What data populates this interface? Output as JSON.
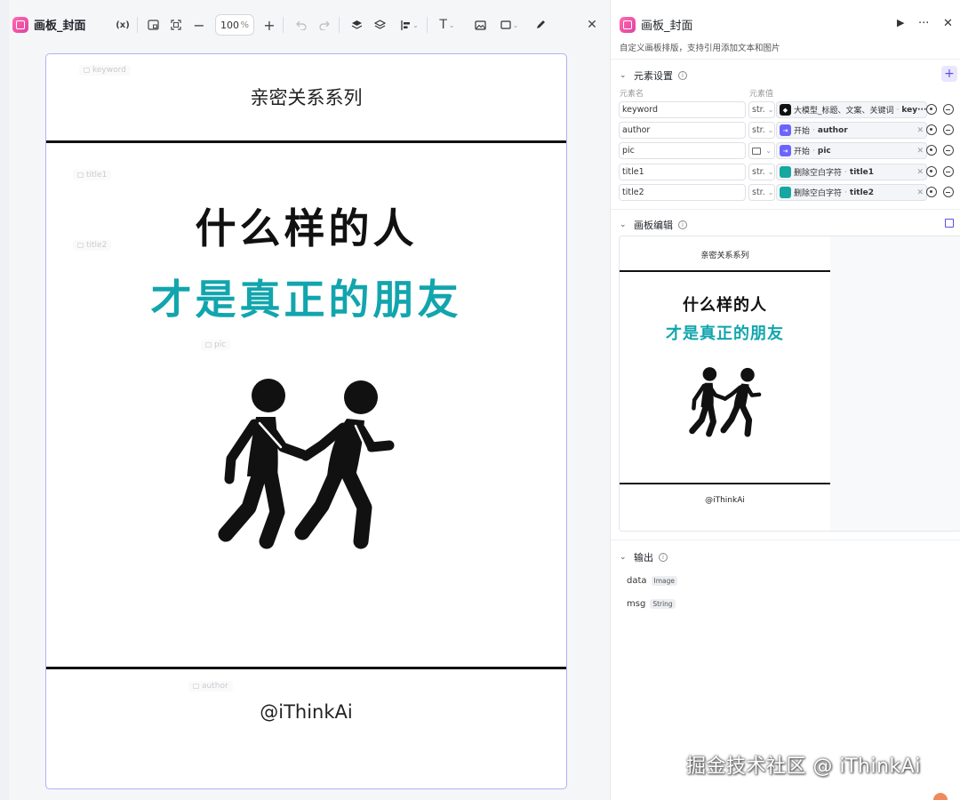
{
  "editor": {
    "title": "画板_封面",
    "zoom_value": "100",
    "zoom_unit": "%",
    "icons": [
      "variable-icon",
      "canvas-size-icon",
      "fit-screen-icon",
      "zoom-out-icon",
      "zoom-in-icon",
      "undo-icon",
      "redo-icon",
      "layer-up-icon",
      "layers-icon",
      "align-icon",
      "text-icon",
      "image-icon",
      "shape-icon",
      "pen-icon",
      "close-icon"
    ]
  },
  "canvas": {
    "placeholders": {
      "keyword": "keyword",
      "title1": "title1",
      "title2": "title2",
      "pic": "pic",
      "author": "author"
    },
    "keyword_text": "亲密关系系列",
    "title1_text": "什么样的人",
    "title2_text": "才是真正的朋友",
    "author_text": "@iThinkAi",
    "accent_color": "#12a5ad"
  },
  "panel": {
    "title": "画板_封面",
    "description": "自定义画板排版，支持引用添加文本和图片",
    "element_section": {
      "title": "元素设置",
      "col_name": "元素名",
      "col_value": "元素值",
      "rows": [
        {
          "name": "keyword",
          "type": "str.",
          "source_icon": "llm-icon",
          "node": "大模型_标题、文案、关键词",
          "var": "key···"
        },
        {
          "name": "author",
          "type": "str.",
          "source_icon": "start-icon",
          "node": "开始",
          "var": "author"
        },
        {
          "name": "pic",
          "type": "",
          "source_icon": "start-icon",
          "node": "开始",
          "var": "pic"
        },
        {
          "name": "title1",
          "type": "str.",
          "source_icon": "code-icon",
          "node": "删除空白字符",
          "var": "title1"
        },
        {
          "name": "title2",
          "type": "str.",
          "source_icon": "code-icon",
          "node": "删除空白字符",
          "var": "title2"
        }
      ]
    },
    "canvas_section": {
      "title": "画板编辑"
    },
    "output_section": {
      "title": "输出",
      "items": [
        {
          "name": "data",
          "type": "Image"
        },
        {
          "name": "msg",
          "type": "String"
        }
      ]
    }
  },
  "watermark": "掘金技术社区 @ iThinkAi"
}
